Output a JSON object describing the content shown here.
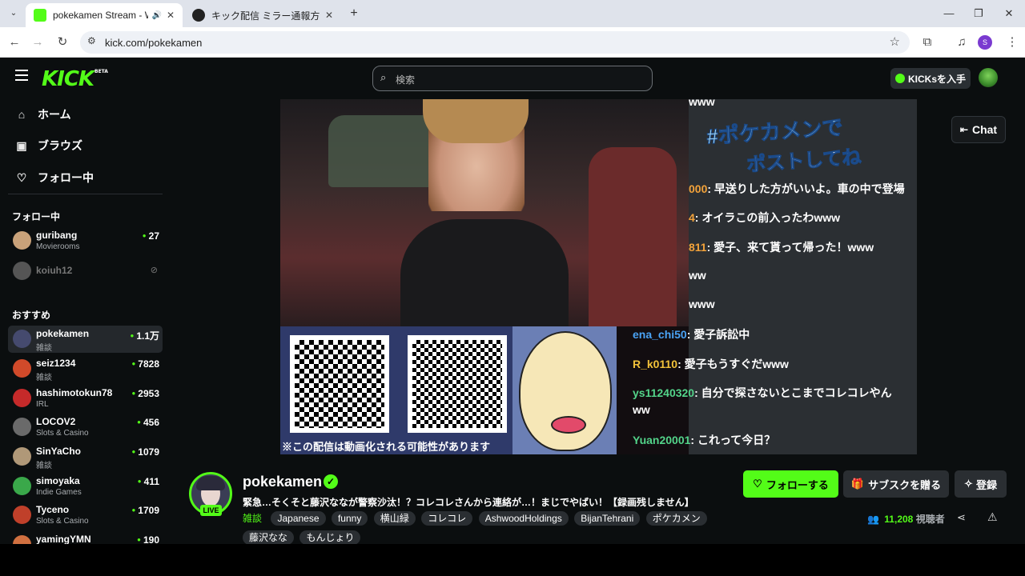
{
  "browser": {
    "tabs": [
      {
        "title": "pokekamen Stream - Watch",
        "active": true
      },
      {
        "title": "キック配信 ミラー通報方法 - Grok",
        "active": false
      }
    ],
    "url": "kick.com/pokekamen",
    "profile_initial": "S"
  },
  "header": {
    "logo": "KICK",
    "logo_badge": "BETA",
    "search_placeholder": "検索",
    "get_kicks_label": "KICKsを入手"
  },
  "sidebar": {
    "nav": [
      {
        "label": "ホーム",
        "icon": "home-icon"
      },
      {
        "label": "ブラウズ",
        "icon": "browse-icon"
      },
      {
        "label": "フォロー中",
        "icon": "heart-icon"
      }
    ],
    "following_heading": "フォロー中",
    "following": [
      {
        "name": "guribang",
        "category": "Movierooms",
        "viewers": "27",
        "color": "#c9a27a"
      },
      {
        "name": "koiuh12",
        "category": "",
        "viewers": "",
        "color": "#555"
      }
    ],
    "recommended_heading": "おすすめ",
    "recommended": [
      {
        "name": "pokekamen",
        "category": "雑談",
        "viewers": "1.1万",
        "color": "#454a6e"
      },
      {
        "name": "seiz1234",
        "category": "雑談",
        "viewers": "7828",
        "color": "#d04a2a"
      },
      {
        "name": "hashimotokun78",
        "category": "IRL",
        "viewers": "2953",
        "color": "#c52a2a"
      },
      {
        "name": "LOCOV2",
        "category": "Slots & Casino",
        "viewers": "456",
        "color": "#6a6a6a"
      },
      {
        "name": "SinYaCho",
        "category": "雑談",
        "viewers": "1079",
        "color": "#b09878"
      },
      {
        "name": "simoyaka",
        "category": "Indie Games",
        "viewers": "411",
        "color": "#3aa84a"
      },
      {
        "name": "Tyceno",
        "category": "Slots & Casino",
        "viewers": "1709",
        "color": "#c0402a"
      },
      {
        "name": "yamingYMN",
        "category": "",
        "viewers": "190",
        "color": "#d07040"
      }
    ]
  },
  "player": {
    "overlay_chat": [
      {
        "user": "",
        "msg": "www"
      },
      {
        "user": "000",
        "msg": ": 早送りした方がいいよ。車の中で登場"
      },
      {
        "user": "4",
        "msg": ": オイラこの前入ったわwww"
      },
      {
        "user": "811",
        "msg": ": 愛子、来て貰って帰った！www"
      },
      {
        "user": "",
        "msg": "ww"
      },
      {
        "user": "",
        "msg": "www"
      },
      {
        "user": "ena_chi50",
        "msg": ": 愛子訴訟中"
      },
      {
        "user": "R_k0110",
        "msg": ": 愛子もうすぐだwww"
      },
      {
        "user": "ys11240320",
        "msg": ": 自分で探さないとこまでコレコレやん"
      },
      {
        "user": "",
        "msg": "ww"
      },
      {
        "user": "Yuan20001",
        "msg": ": これって今日？"
      }
    ],
    "hashtag_overlay": "#ポケカメンで",
    "hashtag_sub": "ポストしてね",
    "promo_notice": "※この配信は動画化される可能性があります"
  },
  "chat_button": "Chat",
  "stream": {
    "channel": "pokekamen",
    "live_label": "LIVE",
    "title": "緊急…そくそと藤沢ななが警察沙汰！？コレコレさんから連絡が…！まじでやばい！【録画残しません】",
    "category": "雑談",
    "tags": [
      "Japanese",
      "funny",
      "横山緑",
      "コレコレ",
      "AshwoodHoldings",
      "BijanTehrani",
      "ポケカメン",
      "藤沢なな",
      "もんじょり"
    ],
    "follow_label": "フォローする",
    "gift_sub_label": "サブスクを贈る",
    "subscribe_label": "登録",
    "viewer_count": "11,208",
    "viewer_label": "視聴者"
  },
  "colors": {
    "accent": "#53fc18",
    "background": "#0b0e0f"
  }
}
